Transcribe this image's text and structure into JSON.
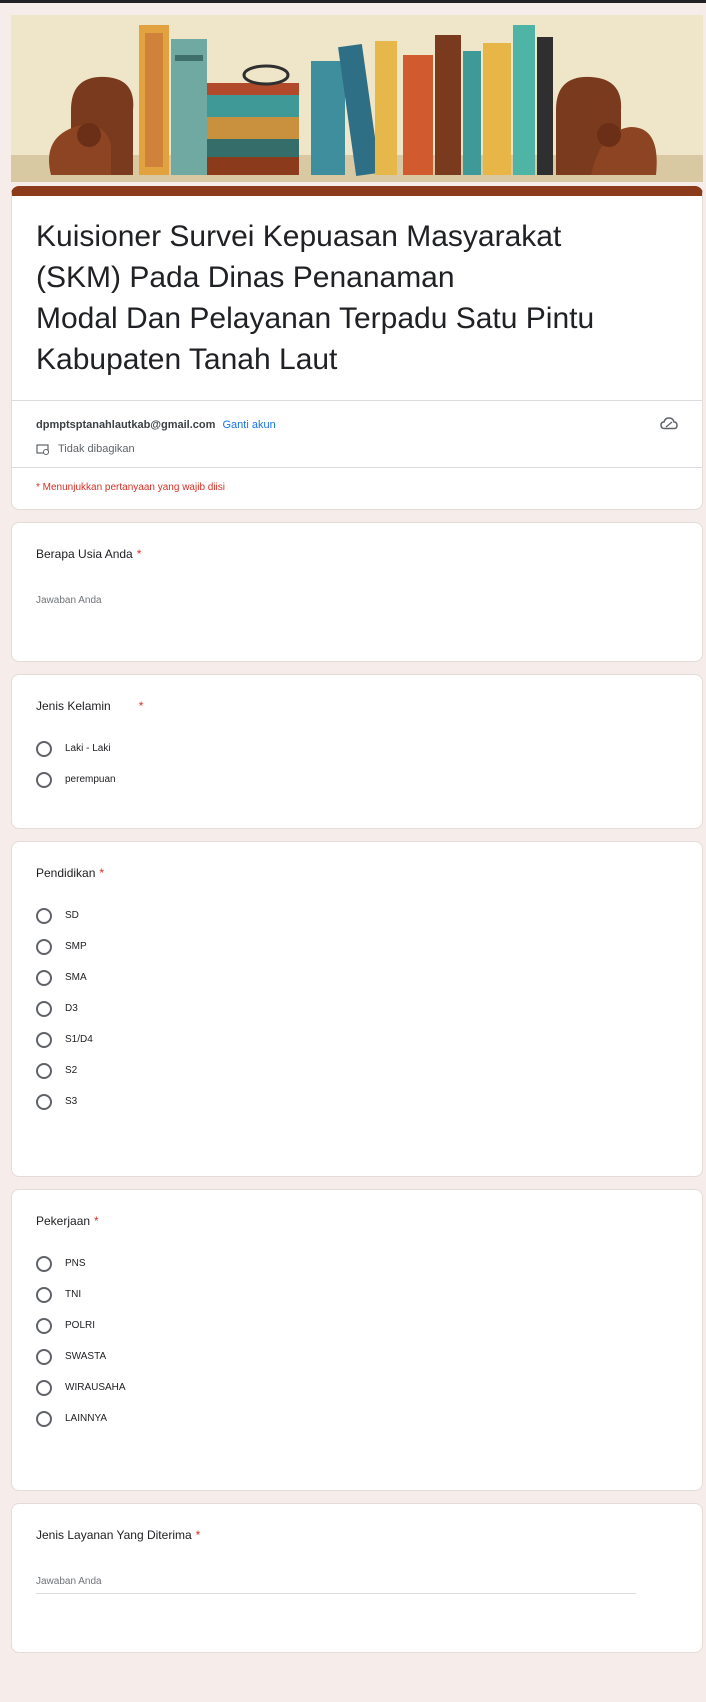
{
  "form": {
    "title": "Kuisioner Survei Kepuasan Masyarakat\n(SKM)          Pada Dinas Penanaman\nModal Dan Pelayanan Terpadu Satu Pintu\nKabupaten Tanah Laut",
    "account_email": "dpmptsptanahlautkab@gmail.com",
    "switch_account": "Ganti akun",
    "not_shared": "Tidak dibagikan",
    "required_note": "* Menunjukkan pertanyaan yang wajib diisi"
  },
  "colors": {
    "theme": "#8b3a1c",
    "background": "#f6ece9",
    "required": "#d93025",
    "link": "#1a73e8"
  },
  "questions": [
    {
      "title": "Berapa Usia Anda",
      "required_mark": "*",
      "type": "text",
      "placeholder": "Jawaban Anda"
    },
    {
      "title": "Jenis Kelamin",
      "required_mark": "*",
      "type": "radio",
      "options": [
        "Laki - Laki",
        "perempuan"
      ]
    },
    {
      "title": "Pendidikan",
      "required_mark": "*",
      "type": "radio",
      "options": [
        "SD",
        "SMP",
        "SMA",
        "D3",
        "S1/D4",
        "S2",
        "S3"
      ]
    },
    {
      "title": "Pekerjaan",
      "required_mark": "*",
      "type": "radio",
      "options": [
        "PNS",
        "TNI",
        "POLRI",
        "SWASTA",
        "WIRAUSAHA",
        "LAINNYA"
      ]
    },
    {
      "title": "Jenis Layanan Yang Diterima",
      "required_mark": "*",
      "type": "text",
      "placeholder": "Jawaban Anda"
    }
  ],
  "icons": [
    "cloud-icon",
    "not-shared-icon",
    "radio-icon"
  ]
}
